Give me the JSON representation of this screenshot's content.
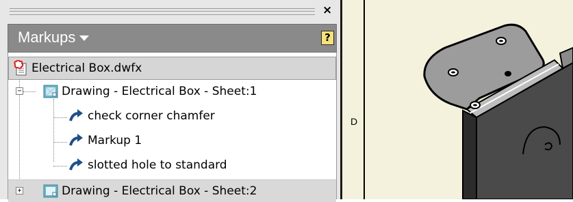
{
  "palette": {
    "close_glyph": "×",
    "title": "Markups",
    "help_glyph": "?"
  },
  "tree": {
    "root": {
      "label": "Electrical Box.dwfx",
      "icon": "dwfx-file-icon"
    },
    "sheets": [
      {
        "label": "Drawing - Electrical Box - Sheet:1",
        "expanded": true,
        "expander": "−",
        "markups": [
          {
            "label": "check corner chamfer",
            "icon": "markup-arrow-icon"
          },
          {
            "label": "Markup 1",
            "icon": "markup-arrow-icon"
          },
          {
            "label": "slotted hole to standard",
            "icon": "markup-arrow-icon"
          }
        ]
      },
      {
        "label": "Drawing - Electrical Box - Sheet:2",
        "expanded": false,
        "expander": "+",
        "markups": []
      }
    ]
  },
  "view": {
    "border_zone_label": "D",
    "colors": {
      "sheet_background": "#f4f2dc",
      "part_dark": "#3c3c3c",
      "part_flange": "#9c9c9c"
    }
  }
}
